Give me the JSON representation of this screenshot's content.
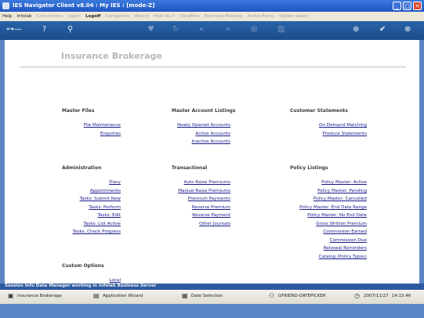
{
  "window": {
    "title": "IES Navigator Client v8.04 : My IES :      [mode-Z]",
    "buttons": {
      "minimize": "_",
      "maximize": "□",
      "close": "✕"
    }
  },
  "menu": {
    "help": "Help",
    "infolab": "Infolab",
    "connections": "Connections",
    "logon": "Logon",
    "logoff": "Logoff",
    "companies": "Companies",
    "wizard": "Wizard",
    "how_do_i": "How Do I?",
    "datafiles": "DataFiles",
    "business_modules": "Business Modules",
    "action_focus": "Action Focus",
    "option_select": "Option Select"
  },
  "toolbar": {
    "key_icon": "key-icon",
    "help_glyph": "?",
    "search_glyph": "🔍"
  },
  "page": {
    "title": "Insurance Brokerage",
    "sections": {
      "master_files": "Master Files",
      "master_account_listings": "Master Account Listings",
      "customer_statements": "Customer Statements",
      "administration": "Administration",
      "transactional": "Transactional",
      "policy_listings": "Policy Listings",
      "custom_options": "Custom Options"
    },
    "master_files": [
      "File Maintenance",
      "Enquiries"
    ],
    "master_account_listings": [
      "Newly Opened Accounts",
      "Active Accounts",
      "Inactive Accounts"
    ],
    "customer_statements": [
      "On Demand Matching",
      "Produce Statements"
    ],
    "administration": [
      "Diary",
      "Appointments",
      "Tasks: Submit New",
      "Tasks: Perform",
      "Tasks: Edit",
      "Tasks: List Active",
      "Tasks: Check Progress"
    ],
    "transactional": [
      "Auto Raise Premiums",
      "Manual Raise Premiums",
      "Premium Payments",
      "Reverse Premium",
      "Reverse Payment",
      "Other Journals"
    ],
    "policy_listings": [
      "Policy Master: Active",
      "Policy Master: Pending",
      "Policy Master: Cancelled",
      "Policy Master: End Date Range",
      "Policy Master: No End Date",
      "Gross Written Premium",
      "Commission Earned",
      "Commission Due",
      "Renewal Reminders",
      "Catalog (Policy Types)"
    ],
    "custom_options": [
      "Local"
    ]
  },
  "status": {
    "text": "Session Info Data Manager working in Infolab Business Server"
  },
  "taskbar": {
    "insurance_brokerage": "Insurance Brokerage",
    "application_wizard": "Application Wizard",
    "date_selection": "Date Selection",
    "user": "GFRIEND-DATEPICKER",
    "date": "2007/11/27",
    "time": "14:15:46"
  }
}
